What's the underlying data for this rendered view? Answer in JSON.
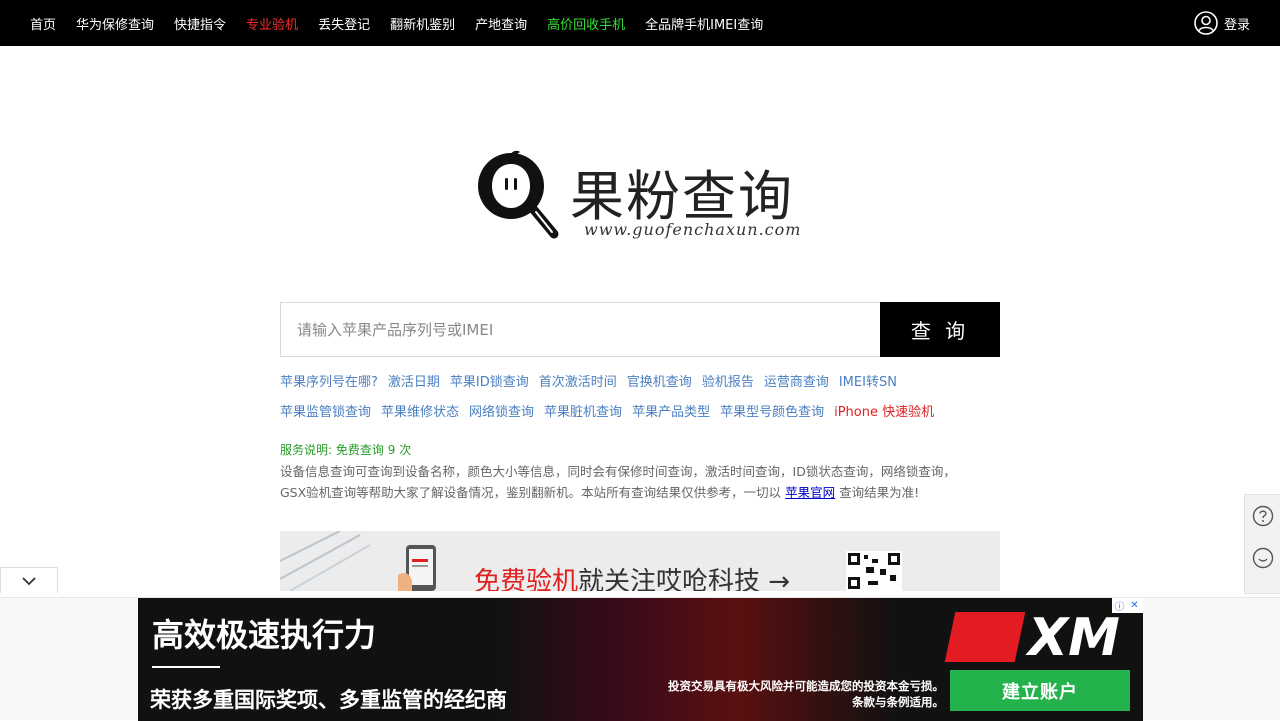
{
  "nav": {
    "items": [
      {
        "label": "首页",
        "style": "normal"
      },
      {
        "label": "华为保修查询",
        "style": "normal"
      },
      {
        "label": "快捷指令",
        "style": "normal"
      },
      {
        "label": "专业验机",
        "style": "red"
      },
      {
        "label": "丢失登记",
        "style": "normal"
      },
      {
        "label": "翻新机鉴别",
        "style": "normal"
      },
      {
        "label": "产地查询",
        "style": "normal"
      },
      {
        "label": "高价回收手机",
        "style": "green"
      },
      {
        "label": "全品牌手机IMEI查询",
        "style": "normal"
      }
    ],
    "login_label": "登录"
  },
  "logo": {
    "title": "果粉查询",
    "url": "www.guofenchaxun.com"
  },
  "search": {
    "placeholder": "请输入苹果产品序列号或IMEI",
    "value": "",
    "button_label": "查 询"
  },
  "quick_links_row1": [
    {
      "label": "苹果序列号在哪?"
    },
    {
      "label": "激活日期"
    },
    {
      "label": "苹果ID锁查询"
    },
    {
      "label": "首次激活时间"
    },
    {
      "label": "官换机查询"
    },
    {
      "label": "验机报告"
    },
    {
      "label": "运营商查询"
    },
    {
      "label": "IMEI转SN"
    }
  ],
  "quick_links_row2": [
    {
      "label": "苹果监管锁查询"
    },
    {
      "label": "苹果维修状态"
    },
    {
      "label": "网络锁查询"
    },
    {
      "label": "苹果脏机查询"
    },
    {
      "label": "苹果产品类型"
    },
    {
      "label": "苹果型号颜色查询"
    },
    {
      "label": "iPhone 快速验机",
      "style": "red"
    }
  ],
  "service": {
    "label": "服务说明:",
    "free_text": "免费查询",
    "count": "9",
    "unit": "次"
  },
  "description": {
    "line1": "设备信息查询可查询到设备名称，颜色大小等信息，同时会有保修时间查询，激活时间查询，ID锁状态查询，网络锁查询，",
    "line2_before": "GSX验机查询等帮助大家了解设备情况，鉴别翻新机。本站所有查询结果仅供参考，一切以",
    "link": "苹果官网",
    "line2_after": "查询结果为准!"
  },
  "banner": {
    "highlight": "免费验机",
    "rest": "就关注哎呛科技 →"
  },
  "ad": {
    "headline": "高效极速执行力",
    "subline": "荣获多重国际奖项、多重监管的经纪商",
    "brand": "XM",
    "risk_line1": "投资交易具有极大风险并可能造成您的投资本金亏损。",
    "risk_line2": "条款与条例适用。",
    "cta_label": "建立账户",
    "adchoice_info": "ⓘ",
    "adchoice_close": "✕"
  },
  "colors": {
    "topbar": "#000000",
    "nav_red": "#ff2a2a",
    "nav_green": "#33e133",
    "link_blue": "#4a7fc1",
    "service_green": "#2a9a2a",
    "cta_green": "#23b24b",
    "brand_red": "#e31b23"
  }
}
